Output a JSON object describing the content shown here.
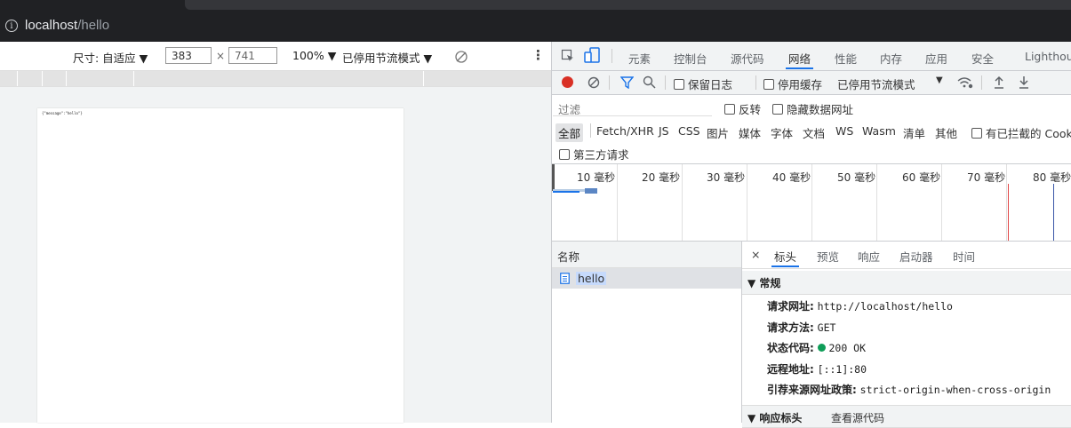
{
  "browser": {
    "host": "localhost",
    "path": "/hello"
  },
  "device_toolbar": {
    "size_label": "尺寸: 自适应 ▼",
    "width": "383",
    "times": "×",
    "height": "741",
    "zoom": "100% ▼",
    "throttle": "已停用节流模式 ▼"
  },
  "page_content": "{\"message\":\"hello\"}",
  "devtools": {
    "tabs": [
      "元素",
      "控制台",
      "源代码",
      "网络",
      "性能",
      "内存",
      "应用",
      "安全",
      "Lighthouse"
    ],
    "active_tab": "网络",
    "network_toolbar": {
      "preserve_log": "保留日志",
      "disable_cache": "停用缓存",
      "throttle": "已停用节流模式",
      "throttle_arrow": "▼"
    },
    "filter": {
      "placeholder": "过滤",
      "invert": "反转",
      "hide_data_urls": "隐藏数据网址"
    },
    "types": [
      "全部",
      "Fetch/XHR",
      "JS",
      "CSS",
      "图片",
      "媒体",
      "字体",
      "文档",
      "WS",
      "Wasm",
      "清单",
      "其他"
    ],
    "blocked_cookies": "有已拦截的 Cookie",
    "third_party": "第三方请求",
    "timeline_labels": [
      "10 毫秒",
      "20 毫秒",
      "30 毫秒",
      "40 毫秒",
      "50 毫秒",
      "60 毫秒",
      "70 毫秒",
      "80 毫秒"
    ],
    "name_header": "名称",
    "request_name": "hello",
    "detail_tabs": {
      "close": "×",
      "headers": "标头",
      "preview": "预览",
      "response": "响应",
      "initiator": "启动器",
      "timing": "时间"
    },
    "general": {
      "title": "▼ 常规",
      "request_url_label": "请求网址:",
      "request_url": "http://localhost/hello",
      "method_label": "请求方法:",
      "method": "GET",
      "status_label": "状态代码:",
      "status": "200 OK",
      "remote_label": "远程地址:",
      "remote": "[::1]:80",
      "referrer_label": "引荐来源网址政策:",
      "referrer": "strict-origin-when-cross-origin"
    },
    "response_headers": {
      "title": "▼ 响应标头",
      "view_source": "查看源代码"
    }
  },
  "colors": {
    "accent": "#1a73e8",
    "record_red": "#d93025",
    "status_green": "#0f9d58"
  }
}
